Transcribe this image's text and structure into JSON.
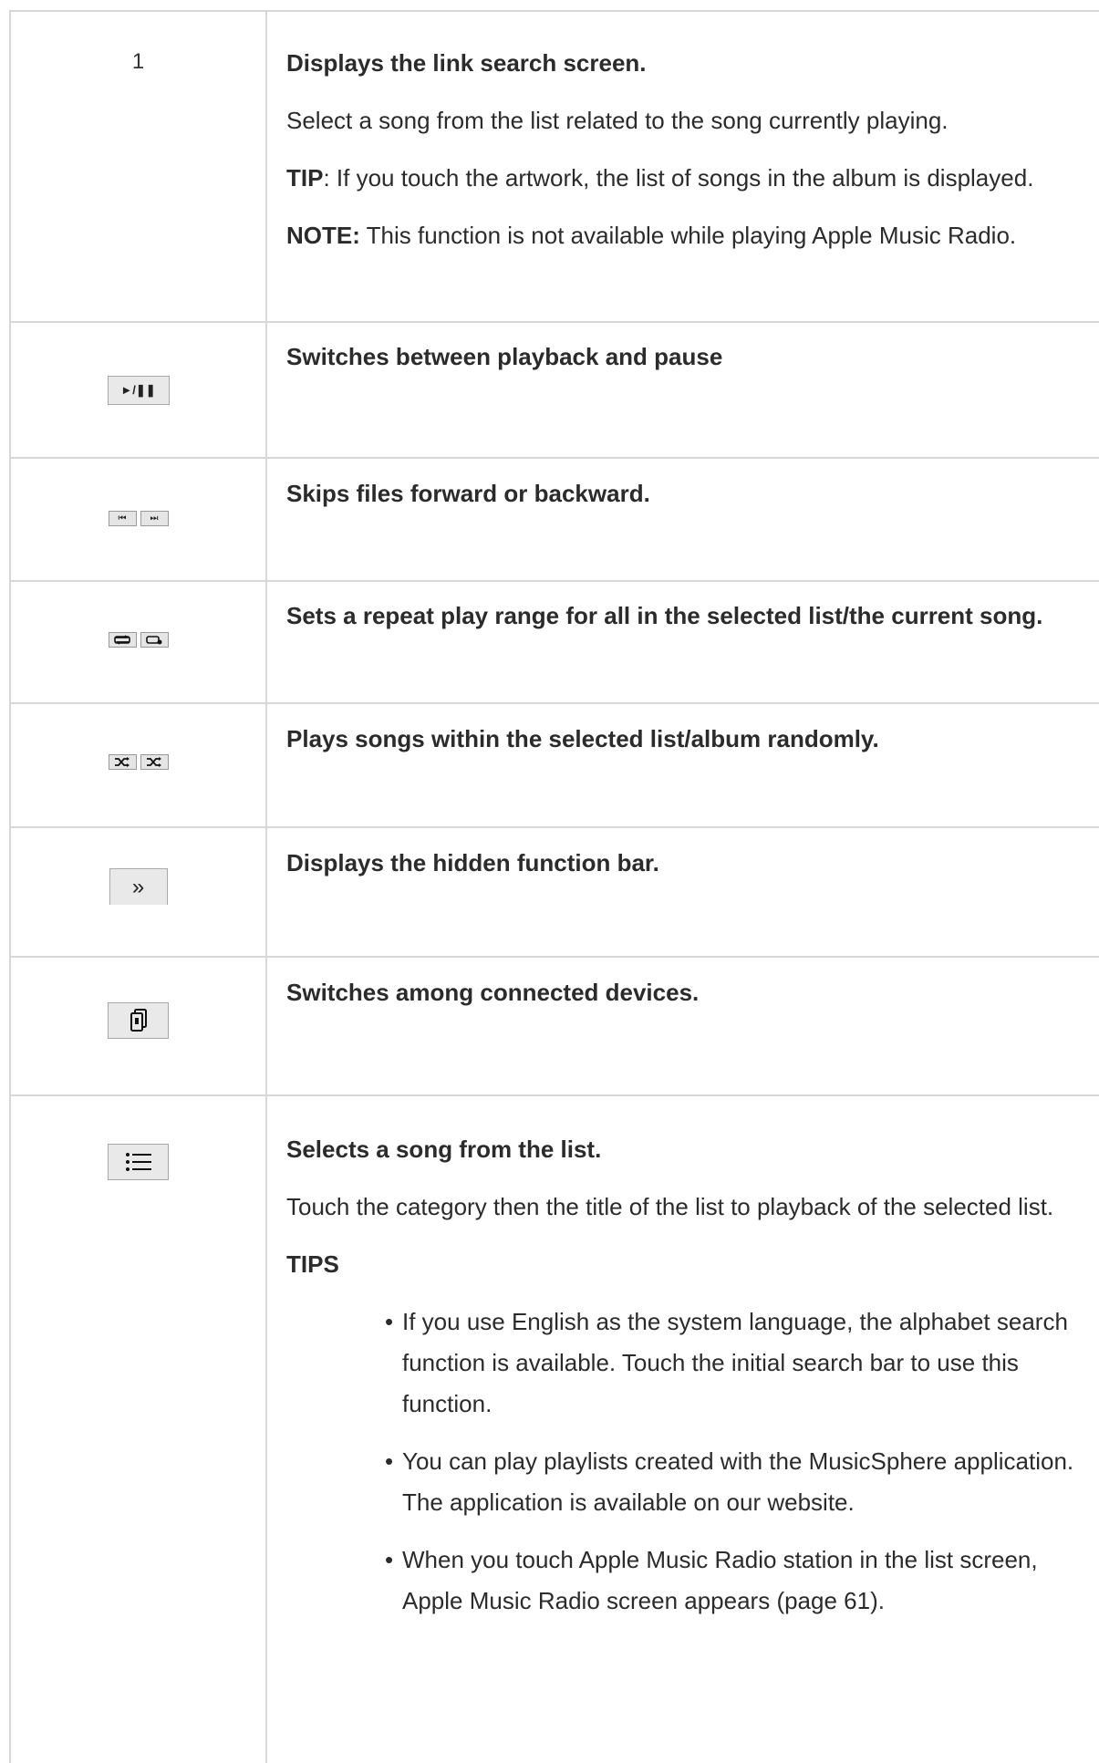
{
  "rows": [
    {
      "key": "1",
      "title": "Displays the link search screen.",
      "p1": "Select a song from the list related to the song currently playing.",
      "tip_label": "TIP",
      "tip_text": ": If you touch the artwork, the list of songs in the album is displayed.",
      "note_label": "NOTE:",
      "note_text": " This function is not available while playing Apple Music Radio."
    },
    {
      "icon": "play-pause-icon",
      "icon_text": "►/❚❚",
      "title": "Switches between playback and pause"
    },
    {
      "icon": "skip-icons",
      "icon_text_a": "⏮",
      "icon_text_b": "⏭",
      "title": "Skips files forward or backward."
    },
    {
      "icon": "repeat-icons",
      "title": "Sets a repeat play range for all in the selected list/the current song."
    },
    {
      "icon": "shuffle-icons",
      "title": "Plays songs within the selected list/album randomly."
    },
    {
      "icon": "chevron-right-double-icon",
      "icon_text": "»",
      "title": "Displays the hidden function bar."
    },
    {
      "icon": "device-switch-icon",
      "title": "Switches among connected devices."
    },
    {
      "icon": "list-icon",
      "title": "Selects a song from the list.",
      "p1": "Touch the category then the title of the list to playback of the selected list.",
      "tips_label": "TIPS",
      "tips": [
        "If you use English as the system language, the alphabet search function is available. Touch the initial search bar to use this function.",
        "You can play playlists created with the MusicSphere application. The application is available on our website.",
        "When you touch Apple Music Radio station in the list screen, Apple Music Radio screen appears (page 61)."
      ]
    }
  ]
}
